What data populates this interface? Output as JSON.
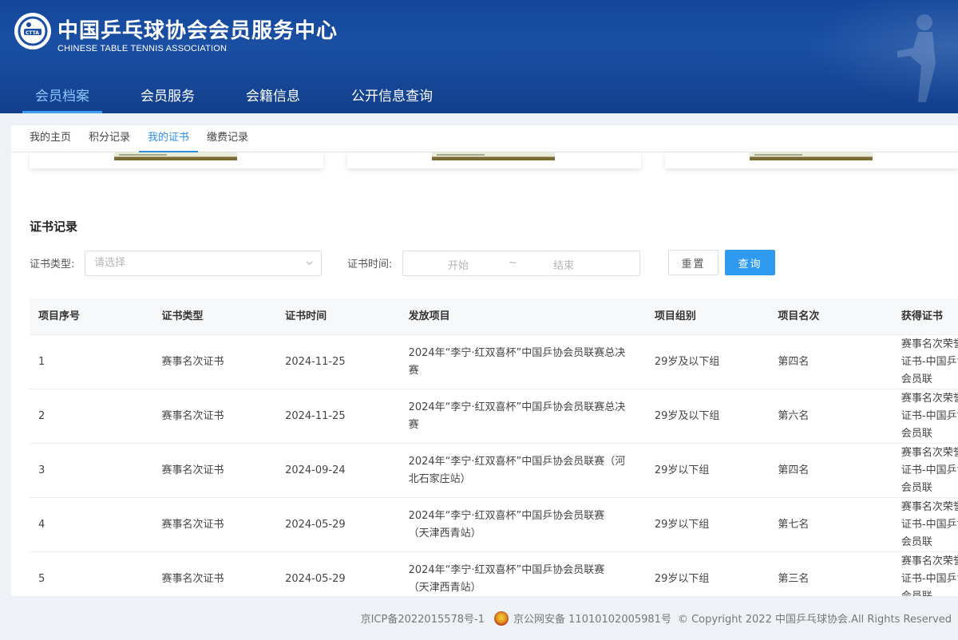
{
  "header": {
    "title_cn": "中国乒乓球协会会员服务中心",
    "title_en": "CHINESE TABLE TENNIS ASSOCIATION",
    "nav": [
      {
        "label": "会员档案",
        "active": true
      },
      {
        "label": "会员服务",
        "active": false
      },
      {
        "label": "会籍信息",
        "active": false
      },
      {
        "label": "公开信息查询",
        "active": false
      }
    ]
  },
  "subnav": [
    {
      "label": "我的主页",
      "active": false
    },
    {
      "label": "积分记录",
      "active": false
    },
    {
      "label": "我的证书",
      "active": true
    },
    {
      "label": "缴费记录",
      "active": false
    }
  ],
  "section": {
    "title": "证书记录"
  },
  "filters": {
    "type_label": "证书类型:",
    "type_placeholder": "请选择",
    "time_label": "证书时间:",
    "start_placeholder": "开始",
    "separator": "~",
    "end_placeholder": "结束",
    "reset_label": "重置",
    "query_label": "查询"
  },
  "table": {
    "columns": [
      "项目序号",
      "证书类型",
      "证书时间",
      "发放项目",
      "项目组别",
      "项目名次",
      "获得证书"
    ],
    "rows": [
      [
        "1",
        "赛事名次证书",
        "2024-11-25",
        "2024年“李宁·红双喜杯”中国乒协会员联赛总决赛",
        "29岁及以下组",
        "第四名",
        "赛事名次荣誉证书-中国乒协会员联"
      ],
      [
        "2",
        "赛事名次证书",
        "2024-11-25",
        "2024年“李宁·红双喜杯”中国乒协会员联赛总决赛",
        "29岁及以下组",
        "第六名",
        "赛事名次荣誉证书-中国乒协会员联"
      ],
      [
        "3",
        "赛事名次证书",
        "2024-09-24",
        "2024年“李宁·红双喜杯”中国乒协会员联赛（河北石家庄站）",
        "29岁以下组",
        "第四名",
        "赛事名次荣誉证书-中国乒协会员联"
      ],
      [
        "4",
        "赛事名次证书",
        "2024-05-29",
        "2024年“李宁·红双喜杯”中国乒协会员联赛 （天津西青站）",
        "29岁以下组",
        "第七名",
        "赛事名次荣誉证书-中国乒协会员联"
      ],
      [
        "5",
        "赛事名次证书",
        "2024-05-29",
        "2024年“李宁·红双喜杯”中国乒协会员联赛 （天津西青站）",
        "29岁以下组",
        "第三名",
        "赛事名次荣誉证书-中国乒协会员联"
      ]
    ]
  },
  "footer": {
    "icp": "京ICP备2022015578号-1",
    "police": "京公网安备 11010102005981号",
    "copyright": "© Copyright 2022 中国乒乓球协会.All Rights Reserved"
  },
  "colors": {
    "header_blue": "#1a4fa3",
    "accent": "#2e9bf0",
    "nav_active": "#8cc4ff"
  }
}
